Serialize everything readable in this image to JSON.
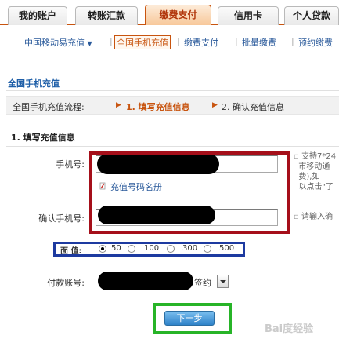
{
  "tabs": [
    {
      "label": "我的账户"
    },
    {
      "label": "转账汇款"
    },
    {
      "label": "缴费支付"
    },
    {
      "label": "信用卡"
    },
    {
      "label": "个人贷款"
    }
  ],
  "subnav": {
    "items": [
      {
        "label": "中国移动易充值"
      },
      {
        "label": "全国手机充值"
      },
      {
        "label": "缴费支付"
      },
      {
        "label": "批量缴费"
      },
      {
        "label": "预约缴费"
      }
    ],
    "separator": "|"
  },
  "section_title": "全国手机充值",
  "flow": {
    "label": "全国手机充值流程:",
    "step1": "1. 填写充值信息",
    "step2": "2. 确认充值信息"
  },
  "form_title": "1. 填写充值信息",
  "fields": {
    "phone_label": "手机号:",
    "phone_value": "",
    "phone_hint": "充值号码名册",
    "confirm_label": "确认手机号:",
    "confirm_value": "",
    "amount_label": "面 值:",
    "amounts": [
      "50",
      "100",
      "300",
      "500"
    ],
    "amount_selected": "50",
    "account_label": "付款账号:",
    "account_suffix": "签约"
  },
  "side_notes": {
    "line1": "支持7*24",
    "line2": "市移动通",
    "line3": "费),如",
    "line4": "以点击\"了",
    "confirm_hint": "请输入确"
  },
  "next_button": "下一步",
  "watermark": "Bai度经验"
}
